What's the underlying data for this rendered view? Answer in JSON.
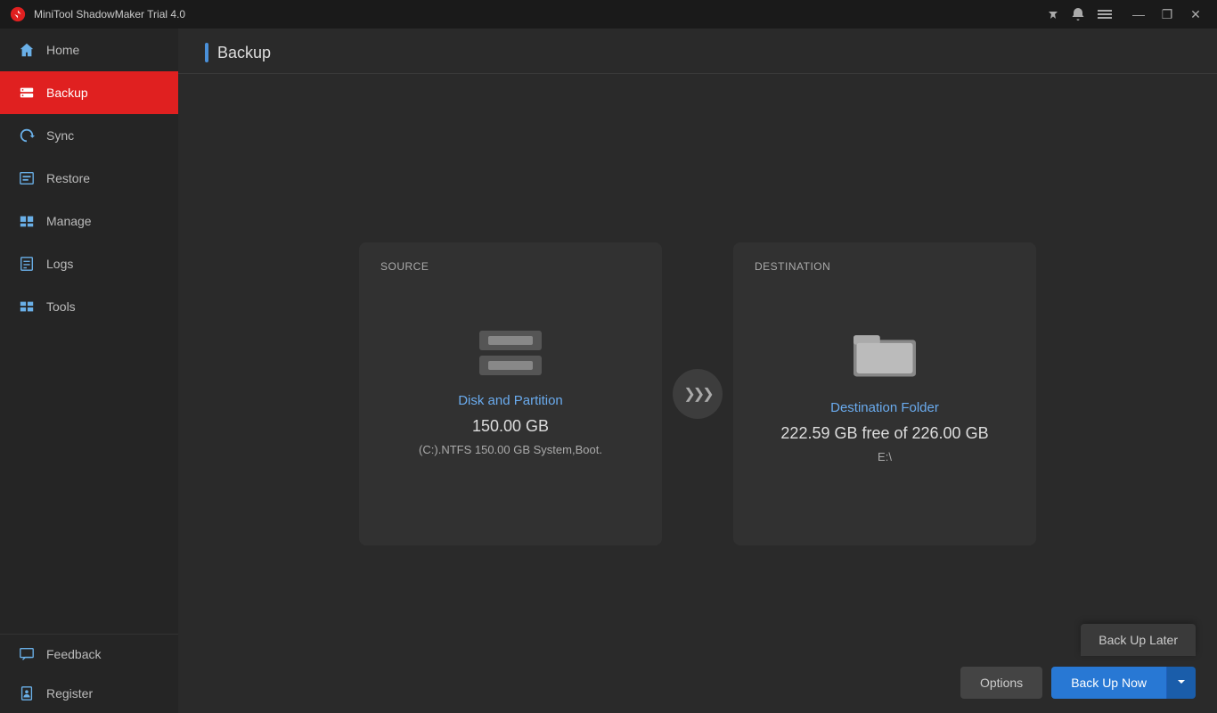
{
  "titleBar": {
    "appName": "MiniTool ShadowMaker Trial 4.0",
    "icons": {
      "pin": "📌",
      "info": "🔔",
      "menu": "☰"
    },
    "controls": {
      "minimize": "—",
      "maximize": "❐",
      "close": "✕"
    }
  },
  "sidebar": {
    "items": [
      {
        "id": "home",
        "label": "Home",
        "active": false
      },
      {
        "id": "backup",
        "label": "Backup",
        "active": true
      },
      {
        "id": "sync",
        "label": "Sync",
        "active": false
      },
      {
        "id": "restore",
        "label": "Restore",
        "active": false
      },
      {
        "id": "manage",
        "label": "Manage",
        "active": false
      },
      {
        "id": "logs",
        "label": "Logs",
        "active": false
      },
      {
        "id": "tools",
        "label": "Tools",
        "active": false
      }
    ],
    "bottom": [
      {
        "id": "feedback",
        "label": "Feedback"
      },
      {
        "id": "register",
        "label": "Register"
      }
    ]
  },
  "pageTitle": "Backup",
  "source": {
    "label": "SOURCE",
    "iconType": "disk",
    "title": "Disk and Partition",
    "size": "150.00 GB",
    "info": "(C:).NTFS 150.00 GB System,Boot."
  },
  "destination": {
    "label": "DESTINATION",
    "iconType": "folder",
    "title": "Destination Folder",
    "freeSpace": "222.59 GB free of 226.00 GB",
    "path": "E:\\"
  },
  "buttons": {
    "options": "Options",
    "backupNow": "Back Up Now",
    "backupLater": "Back Up Later"
  }
}
